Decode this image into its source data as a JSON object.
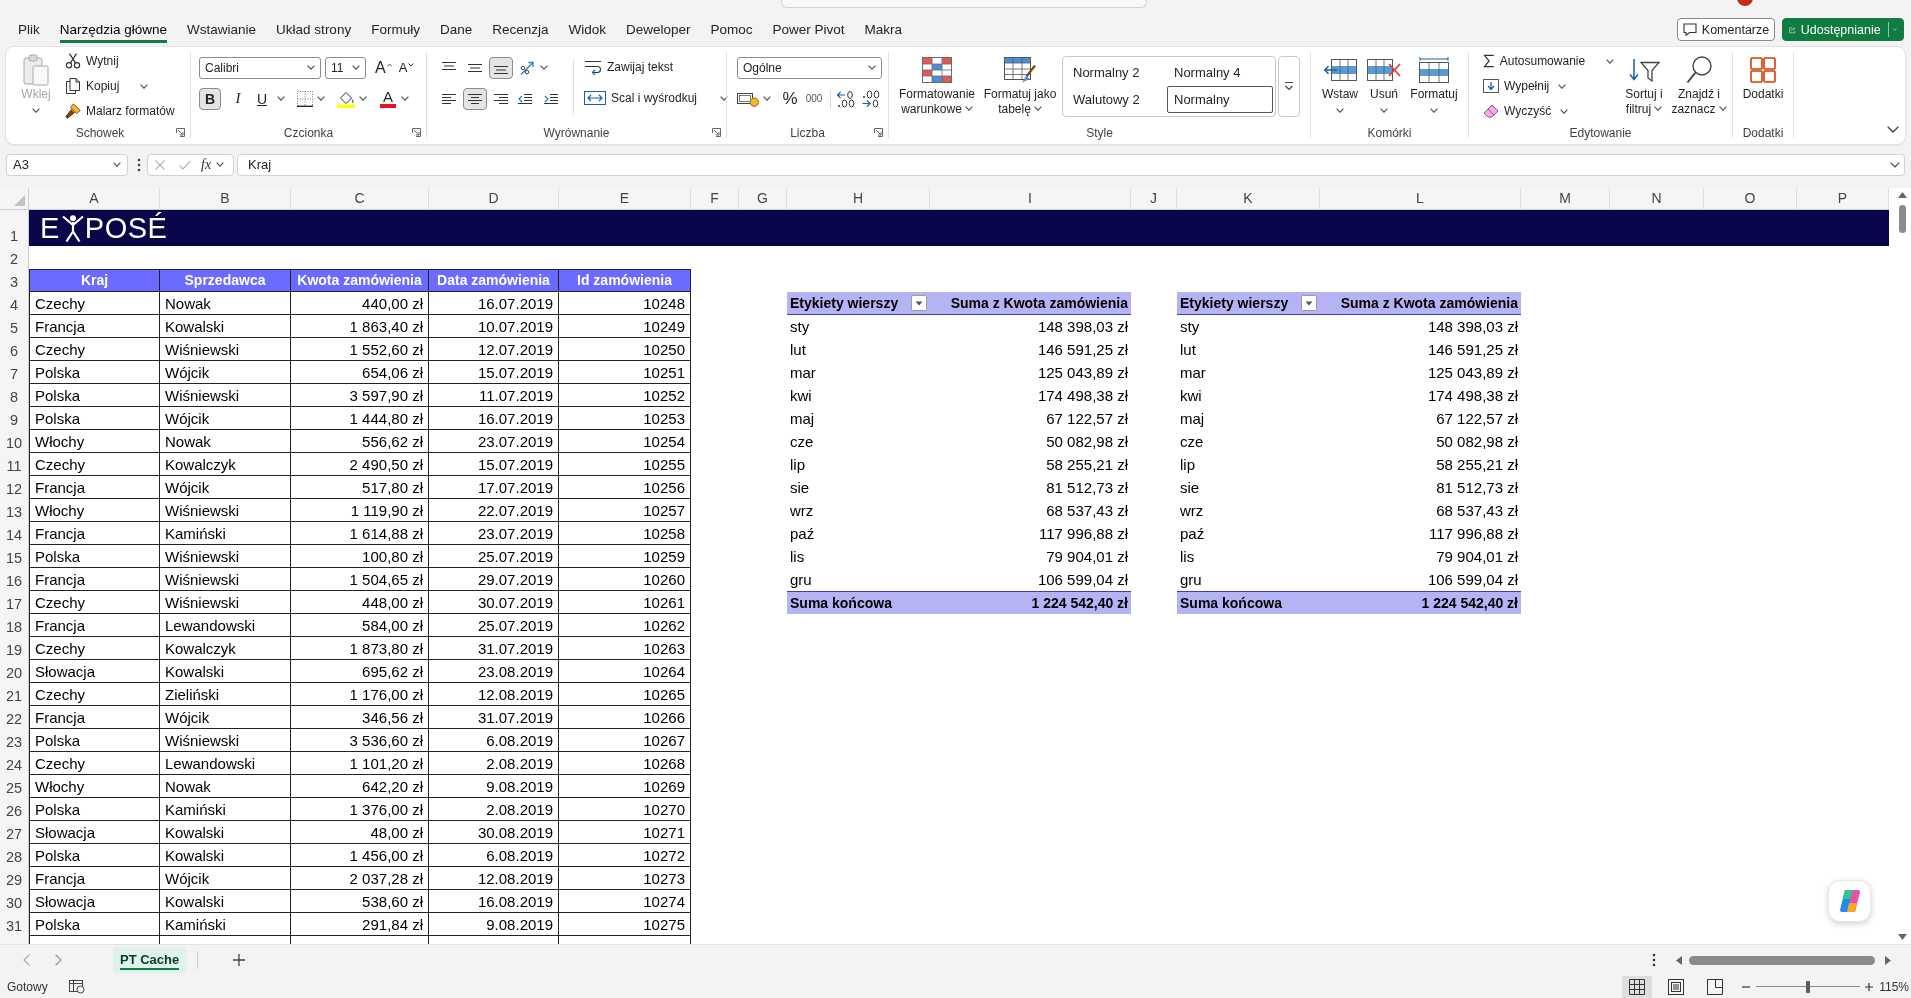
{
  "menu_tabs": [
    {
      "label": "Plik",
      "selected": false
    },
    {
      "label": "Narzędzia główne",
      "selected": true
    },
    {
      "label": "Wstawianie",
      "selected": false
    },
    {
      "label": "Układ strony",
      "selected": false
    },
    {
      "label": "Formuły",
      "selected": false
    },
    {
      "label": "Dane",
      "selected": false
    },
    {
      "label": "Recenzja",
      "selected": false
    },
    {
      "label": "Widok",
      "selected": false
    },
    {
      "label": "Deweloper",
      "selected": false
    },
    {
      "label": "Pomoc",
      "selected": false
    },
    {
      "label": "Power Pivot",
      "selected": false
    },
    {
      "label": "Makra",
      "selected": false
    }
  ],
  "header_buttons": [
    {
      "kind": "comments",
      "label": "Komentarze"
    },
    {
      "kind": "share",
      "label": "Udostępnianie"
    }
  ],
  "ribbon": {
    "groups": [
      {
        "kind": "clipboard",
        "label": "Schowek",
        "launcher": true,
        "controls": [
          {
            "label": "Wklej",
            "disabled": true
          },
          {
            "label": "Wytnij",
            "disabled": false
          },
          {
            "label": "Kopiuj",
            "disabled": false
          },
          {
            "label": "Malarz formatów",
            "disabled": false
          }
        ]
      },
      {
        "kind": "font",
        "label": "Czcionka",
        "launcher": true,
        "font_name": "Calibri",
        "font_size": "11",
        "size_buttons": [
          "A",
          "A"
        ],
        "toggles": [
          {
            "label": "B",
            "on": true
          },
          {
            "label": "I",
            "on": false
          },
          {
            "label": "U",
            "on": false
          }
        ],
        "font_color": "A"
      },
      {
        "kind": "alignment",
        "label": "Wyrównanie",
        "launcher": true,
        "vertical_align": [
          {
            "selected": false
          },
          {
            "selected": false
          },
          {
            "selected": true
          }
        ],
        "horizontal_align": [
          {
            "selected": false
          },
          {
            "selected": true
          },
          {
            "selected": false
          }
        ],
        "wrap_text": {
          "label": "Zawijaj tekst",
          "on": false
        },
        "merge": {
          "label": "Scal i wyśrodkuj"
        }
      },
      {
        "kind": "number",
        "label": "Liczba",
        "launcher": true,
        "format": "Ogólne",
        "symbols": [
          "%",
          "000"
        ]
      },
      {
        "kind": "styles",
        "label": "Style",
        "launcher": false,
        "buttons": [
          {
            "label": "Formatowanie warunkowe"
          },
          {
            "label": "Formatuj jako tabelę"
          }
        ],
        "gallery": [
          {
            "label": "Normalny 2",
            "selected": false
          },
          {
            "label": "Normalny 4",
            "selected": false
          },
          {
            "label": "Walutowy 2",
            "selected": false
          },
          {
            "label": "Normalny",
            "selected": true
          }
        ]
      },
      {
        "kind": "cells",
        "label": "Komórki",
        "launcher": false,
        "buttons": [
          {
            "label": "Wstaw"
          },
          {
            "label": "Usuń"
          },
          {
            "label": "Formatuj"
          }
        ]
      },
      {
        "kind": "editing",
        "label": "Edytowanie",
        "launcher": false,
        "small_buttons": [
          {
            "label": "Autosumowanie"
          },
          {
            "label": "Wypełnij"
          },
          {
            "label": "Wyczyść"
          }
        ],
        "buttons": [
          {
            "label": "Sortuj i filtruj"
          },
          {
            "label": "Znajdź i zaznacz"
          }
        ]
      },
      {
        "kind": "addins",
        "label": "Dodatki",
        "launcher": false,
        "buttons": [
          {
            "label": "Dodatki"
          }
        ]
      }
    ]
  },
  "formula_bar": {
    "name_box": "A3",
    "function_label": "fx",
    "formula": "Kraj"
  },
  "sheet": {
    "column_letters": [
      "A",
      "B",
      "C",
      "D",
      "E",
      "F",
      "G",
      "H",
      "I",
      "J",
      "K",
      "L",
      "M",
      "N",
      "O",
      "P"
    ],
    "row_numbers": [
      "1",
      "2",
      "3",
      "4",
      "5",
      "6",
      "7",
      "8",
      "9",
      "10",
      "11",
      "12",
      "13",
      "14",
      "15",
      "16",
      "17",
      "18",
      "19",
      "20",
      "21",
      "22",
      "23",
      "24",
      "25",
      "26",
      "27",
      "28",
      "29",
      "30",
      "31"
    ],
    "banner": {
      "logo_start": "E",
      "logo_end": "POSÉ"
    },
    "data_table": {
      "columns": [
        "Kraj",
        "Sprzedawca",
        "Kwota zamówienia",
        "Data zamówienia",
        "Id zamówienia"
      ],
      "rows": [
        [
          "Czechy",
          "Nowak",
          "440,00 zł",
          "16.07.2019",
          "10248"
        ],
        [
          "Francja",
          "Kowalski",
          "1 863,40 zł",
          "10.07.2019",
          "10249"
        ],
        [
          "Czechy",
          "Wiśniewski",
          "1 552,60 zł",
          "12.07.2019",
          "10250"
        ],
        [
          "Polska",
          "Wójcik",
          "654,06 zł",
          "15.07.2019",
          "10251"
        ],
        [
          "Polska",
          "Wiśniewski",
          "3 597,90 zł",
          "11.07.2019",
          "10252"
        ],
        [
          "Polska",
          "Wójcik",
          "1 444,80 zł",
          "16.07.2019",
          "10253"
        ],
        [
          "Włochy",
          "Nowak",
          "556,62 zł",
          "23.07.2019",
          "10254"
        ],
        [
          "Czechy",
          "Kowalczyk",
          "2 490,50 zł",
          "15.07.2019",
          "10255"
        ],
        [
          "Francja",
          "Wójcik",
          "517,80 zł",
          "17.07.2019",
          "10256"
        ],
        [
          "Włochy",
          "Wiśniewski",
          "1 119,90 zł",
          "22.07.2019",
          "10257"
        ],
        [
          "Francja",
          "Kamiński",
          "1 614,88 zł",
          "23.07.2019",
          "10258"
        ],
        [
          "Polska",
          "Wiśniewski",
          "100,80 zł",
          "25.07.2019",
          "10259"
        ],
        [
          "Francja",
          "Wiśniewski",
          "1 504,65 zł",
          "29.07.2019",
          "10260"
        ],
        [
          "Czechy",
          "Wiśniewski",
          "448,00 zł",
          "30.07.2019",
          "10261"
        ],
        [
          "Francja",
          "Lewandowski",
          "584,00 zł",
          "25.07.2019",
          "10262"
        ],
        [
          "Czechy",
          "Kowalczyk",
          "1 873,80 zł",
          "31.07.2019",
          "10263"
        ],
        [
          "Słowacja",
          "Kowalski",
          "695,62 zł",
          "23.08.2019",
          "10264"
        ],
        [
          "Czechy",
          "Zieliński",
          "1 176,00 zł",
          "12.08.2019",
          "10265"
        ],
        [
          "Francja",
          "Wójcik",
          "346,56 zł",
          "31.07.2019",
          "10266"
        ],
        [
          "Polska",
          "Wiśniewski",
          "3 536,60 zł",
          "6.08.2019",
          "10267"
        ],
        [
          "Czechy",
          "Lewandowski",
          "1 101,20 zł",
          "2.08.2019",
          "10268"
        ],
        [
          "Włochy",
          "Nowak",
          "642,20 zł",
          "9.08.2019",
          "10269"
        ],
        [
          "Polska",
          "Kamiński",
          "1 376,00 zł",
          "2.08.2019",
          "10270"
        ],
        [
          "Słowacja",
          "Kowalski",
          "48,00 zł",
          "30.08.2019",
          "10271"
        ],
        [
          "Polska",
          "Kowalski",
          "1 456,00 zł",
          "6.08.2019",
          "10272"
        ],
        [
          "Francja",
          "Wójcik",
          "2 037,28 zł",
          "12.08.2019",
          "10273"
        ],
        [
          "Słowacja",
          "Kowalski",
          "538,60 zł",
          "16.08.2019",
          "10274"
        ],
        [
          "Polska",
          "Kamiński",
          "291,84 zł",
          "9.08.2019",
          "10275"
        ]
      ]
    },
    "pivot_tables": [
      {
        "header": [
          "Etykiety wierszy",
          "Suma z Kwota zamówienia"
        ],
        "rows": [
          {
            "label": "sty",
            "value": "148 398,03 zł"
          },
          {
            "label": "lut",
            "value": "146 591,25 zł"
          },
          {
            "label": "mar",
            "value": "125 043,89 zł"
          },
          {
            "label": "kwi",
            "value": "174 498,38 zł"
          },
          {
            "label": "maj",
            "value": "67 122,57 zł"
          },
          {
            "label": "cze",
            "value": "50 082,98 zł"
          },
          {
            "label": "lip",
            "value": "58 255,21 zł"
          },
          {
            "label": "sie",
            "value": "81 512,73 zł"
          },
          {
            "label": "wrz",
            "value": "68 537,43 zł"
          },
          {
            "label": "paź",
            "value": "117 996,88 zł"
          },
          {
            "label": "lis",
            "value": "79 904,01 zł"
          },
          {
            "label": "gru",
            "value": "106 599,04 zł"
          }
        ],
        "total": {
          "label": "Suma końcowa",
          "value": "1 224 542,40 zł"
        }
      },
      {
        "header": [
          "Etykiety wierszy",
          "Suma z Kwota zamówienia"
        ],
        "rows": [
          {
            "label": "sty",
            "value": "148 398,03 zł"
          },
          {
            "label": "lut",
            "value": "146 591,25 zł"
          },
          {
            "label": "mar",
            "value": "125 043,89 zł"
          },
          {
            "label": "kwi",
            "value": "174 498,38 zł"
          },
          {
            "label": "maj",
            "value": "67 122,57 zł"
          },
          {
            "label": "cze",
            "value": "50 082,98 zł"
          },
          {
            "label": "lip",
            "value": "58 255,21 zł"
          },
          {
            "label": "sie",
            "value": "81 512,73 zł"
          },
          {
            "label": "wrz",
            "value": "68 537,43 zł"
          },
          {
            "label": "paź",
            "value": "117 996,88 zł"
          },
          {
            "label": "lis",
            "value": "79 904,01 zł"
          },
          {
            "label": "gru",
            "value": "106 599,04 zł"
          }
        ],
        "total": {
          "label": "Suma końcowa",
          "value": "1 224 542,40 zł"
        }
      }
    ]
  },
  "sheet_tabs": [
    {
      "label": "PT Cache",
      "selected": true
    }
  ],
  "status_bar": {
    "status": "Gotowy",
    "views": [
      {
        "selected": true
      },
      {
        "selected": false
      },
      {
        "selected": false
      }
    ],
    "zoom": {
      "level": 0.5,
      "label": "115%"
    }
  }
}
